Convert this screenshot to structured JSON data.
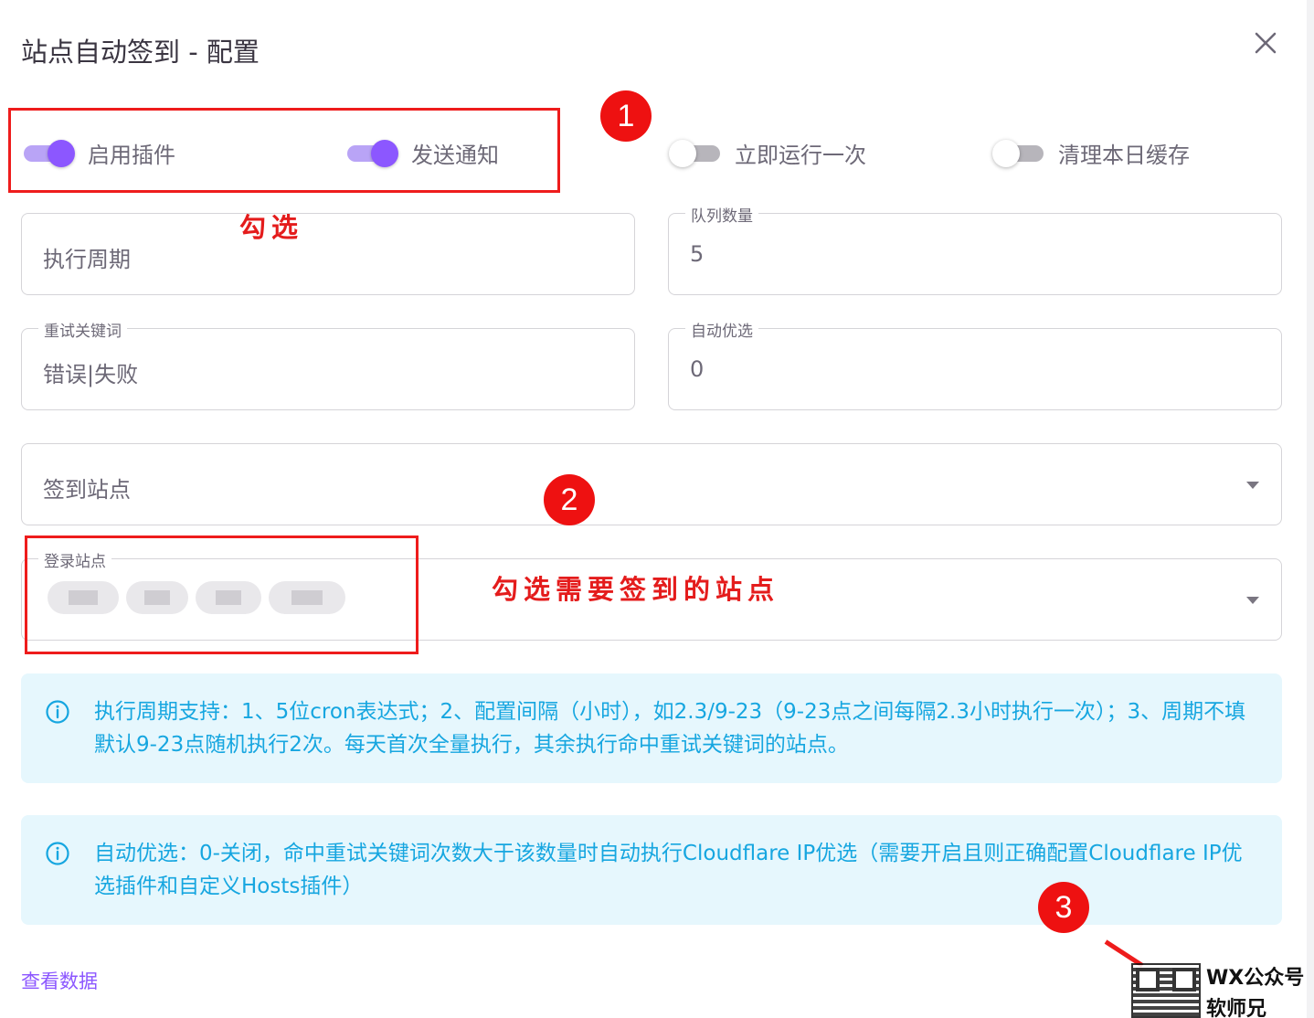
{
  "dialog": {
    "title": "站点自动签到 - 配置",
    "close_icon": "close-icon"
  },
  "switches": [
    {
      "label": "启用插件",
      "checked": true
    },
    {
      "label": "发送通知",
      "checked": true
    },
    {
      "label": "立即运行一次",
      "checked": false
    },
    {
      "label": "清理本日缓存",
      "checked": false
    }
  ],
  "fields": {
    "cron": {
      "placeholder": "执行周期",
      "value": ""
    },
    "queue": {
      "label": "队列数量",
      "value": "5"
    },
    "retry_keywords": {
      "label": "重试关键词",
      "value": "错误|失败"
    },
    "auto_optimize": {
      "label": "自动优选",
      "value": "0"
    },
    "sign_sites": {
      "placeholder": "签到站点"
    },
    "login_sites": {
      "label": "登录站点"
    }
  },
  "alerts": [
    {
      "icon": "info-icon",
      "text": "执行周期支持：1、5位cron表达式；2、配置间隔（小时），如2.3/9-23（9-23点之间每隔2.3小时执行一次）；3、周期不填默认9-23点随机执行2次。每天首次全量执行，其余执行命中重试关键词的站点。"
    },
    {
      "icon": "info-icon",
      "text": "自动优选：0-关闭，命中重试关键词次数大于该数量时自动执行Cloudflare IP优选（需要开启且则正确配置Cloudflare IP优选插件和自定义Hosts插件）"
    }
  ],
  "footer": {
    "link": "查看数据"
  },
  "annotations": {
    "badges": [
      "1",
      "2",
      "3"
    ],
    "note_check": "勾选",
    "note_sites": "勾选需要签到的站点",
    "color": "#ee1c1c"
  },
  "watermark": {
    "line1": "WX公众号",
    "line2": "软师兄"
  },
  "colors": {
    "accent": "#8c57ff",
    "info": "#16a6e0",
    "info_bg": "#e6f7fd"
  }
}
